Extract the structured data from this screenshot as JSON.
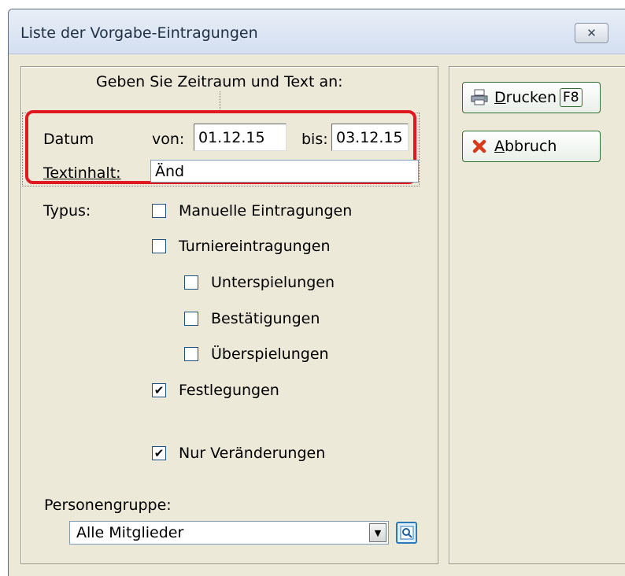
{
  "window": {
    "title": "Liste der Vorgabe-Eintragungen",
    "close_symbol": "✕"
  },
  "heading": "Geben Sie Zeitraum und Text an:",
  "datum": {
    "label": "Datum",
    "von_label": "von:",
    "von_value": "01.12.15",
    "bis_label": "bis:",
    "bis_value": "03.12.15"
  },
  "textinhalt": {
    "label": "Textinhalt:",
    "value": "Änd"
  },
  "typus": {
    "label": "Typus:",
    "options": [
      {
        "label": "Manuelle Eintragungen",
        "checked": false
      },
      {
        "label": "Turniereintragungen",
        "checked": false
      },
      {
        "label": "Unterspielungen",
        "checked": false
      },
      {
        "label": "Bestätigungen",
        "checked": false
      },
      {
        "label": "Überspielungen",
        "checked": false
      },
      {
        "label": "Festlegungen",
        "checked": true
      },
      {
        "label": "Nur Veränderungen",
        "checked": true
      }
    ]
  },
  "personengruppe": {
    "label": "Personengruppe:",
    "selected": "Alle Mitglieder"
  },
  "buttons": {
    "print": {
      "label_rest": "rucken",
      "label_accel": "D",
      "key": "F8"
    },
    "cancel": {
      "label_rest": "bbruch",
      "label_accel": "A"
    }
  },
  "colors": {
    "highlight": "#e01820",
    "accent_green": "#2f6f2f"
  }
}
